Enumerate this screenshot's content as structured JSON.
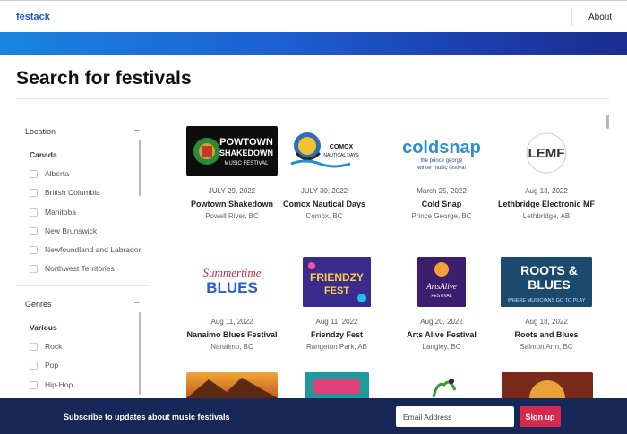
{
  "nav": {
    "brand": "festack",
    "about": "About"
  },
  "page_title": "Search for festivals",
  "filters": {
    "location": {
      "heading": "Location",
      "collapse_symbol": "–",
      "group": "Canada",
      "options": [
        "Alberta",
        "British Columbia",
        "Manitoba",
        "New Brunswick",
        "Newfoundland and Labrador",
        "Northwest Territories"
      ]
    },
    "genres": {
      "heading": "Genres",
      "collapse_symbol": "–",
      "group": "Various",
      "options": [
        "Rock",
        "Pop",
        "Hip-Hop"
      ]
    }
  },
  "festivals": [
    {
      "date": "JULY 29, 2022",
      "name": "Powtown Shakedown",
      "location": "Powell River, BC",
      "logo": [
        "POWTOWN",
        "SHAKEDOWN",
        "MUSIC FESTIVAL"
      ]
    },
    {
      "date": "JULY 30, 2022",
      "name": "Comox Nautical Days",
      "location": "Comox, BC",
      "logo": [
        "COMOX",
        "NAUTICAL DAYS"
      ]
    },
    {
      "date": "March 25, 2022",
      "name": "Cold Snap",
      "location": "Prince George, BC",
      "logo": [
        "coldsnap",
        "the prince george",
        "winter music festival"
      ]
    },
    {
      "date": "Aug 13, 2022",
      "name": "Lethbridge Electronic MF",
      "location": "Lethbridge, AB",
      "logo": [
        "LEMF"
      ]
    },
    {
      "date": "Aug 11, 2022",
      "name": "Nanaimo Blues Festival",
      "location": "Nanaimo, BC",
      "logo": [
        "Summertime",
        "BLUES"
      ]
    },
    {
      "date": "Aug 11, 2022",
      "name": "Friendzy Fest",
      "location": "Rangeton Park, AB",
      "logo": [
        "FRIENDZY",
        "FEST"
      ]
    },
    {
      "date": "Aug 20, 2022",
      "name": "Arts Alive Festival",
      "location": "Langley, BC",
      "logo": [
        "ArtsAlive",
        "FESTIVAL"
      ]
    },
    {
      "date": "Aug 18, 2022",
      "name": "Roots and Blues",
      "location": "Salmon Arm, BC",
      "logo": [
        "ROOTS &",
        "BLUES",
        "WHERE MUSICIANS GO TO PLAY"
      ]
    }
  ],
  "newsletter": {
    "text": "Subscribe to updates about music festivals",
    "placeholder": "Email Address",
    "button": "Sign up"
  },
  "colors": {
    "brand": "#2a55c8",
    "footer": "#172858",
    "signup": "#d32a4e"
  },
  "icons": [
    "collapse-icon",
    "checkbox-icon"
  ]
}
